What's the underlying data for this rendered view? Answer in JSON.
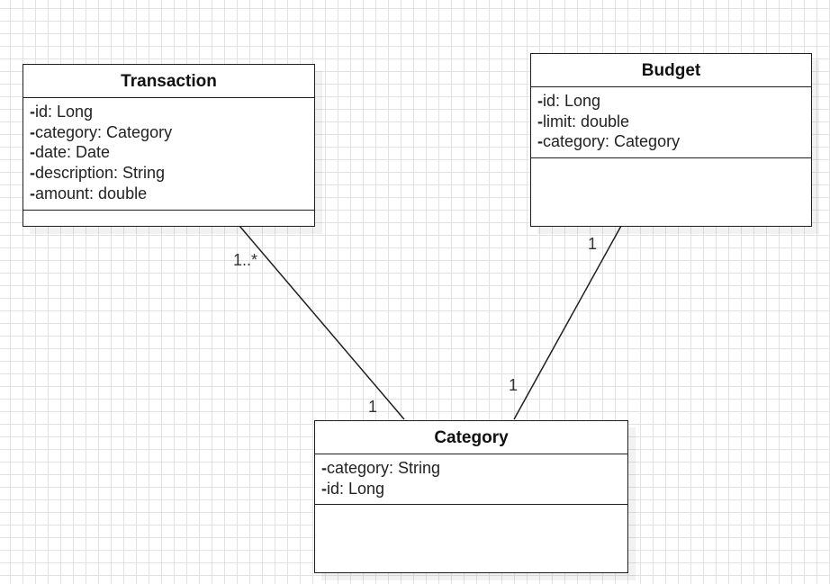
{
  "classes": {
    "transaction": {
      "name": "Transaction",
      "attributes": [
        {
          "visibility": "-",
          "text": "id: Long"
        },
        {
          "visibility": "-",
          "text": "category: Category"
        },
        {
          "visibility": "-",
          "text": "date: Date"
        },
        {
          "visibility": "-",
          "text": "description: String"
        },
        {
          "visibility": "-",
          "text": "amount: double"
        }
      ]
    },
    "budget": {
      "name": "Budget",
      "attributes": [
        {
          "visibility": "-",
          "text": "id: Long"
        },
        {
          "visibility": "-",
          "text": "limit: double"
        },
        {
          "visibility": "-",
          "text": "category: Category"
        }
      ]
    },
    "category": {
      "name": "Category",
      "attributes": [
        {
          "visibility": "-",
          "text": "category: String"
        },
        {
          "visibility": "-",
          "text": "id: Long"
        }
      ]
    }
  },
  "associations": {
    "transaction_category": {
      "source_multiplicity": "1..*",
      "target_multiplicity": "1"
    },
    "budget_category": {
      "source_multiplicity": "1",
      "target_multiplicity": "1"
    }
  }
}
